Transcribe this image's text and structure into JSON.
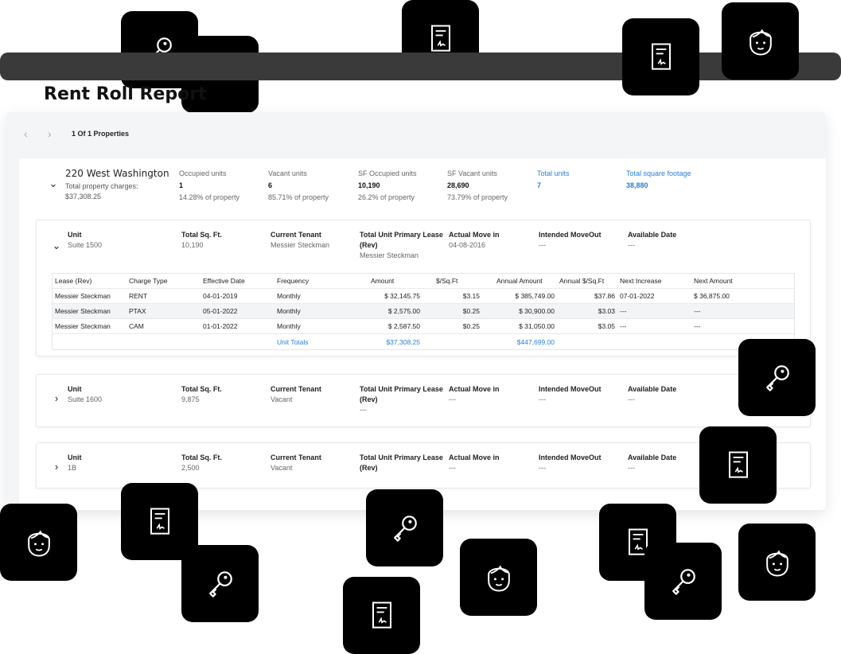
{
  "title": "Rent Roll Report",
  "pager": {
    "text": "1 Of 1 Properties"
  },
  "property": {
    "name": "220 West Washington",
    "charges_label": "Total property charges:",
    "charges_value": "$37,308.25",
    "stats": [
      {
        "label": "Occupied units",
        "value": "1",
        "pct": "14.28% of property"
      },
      {
        "label": "Vacant units",
        "value": "6",
        "pct": "85.71% of property"
      },
      {
        "label": "SF Occupied units",
        "value": "10,190",
        "pct": "26.2% of property"
      },
      {
        "label": "SF Vacant units",
        "value": "28,690",
        "pct": "73.79% of property"
      },
      {
        "label": "Total units",
        "value": "7",
        "pct": ""
      },
      {
        "label": "Total square footage",
        "value": "38,880",
        "pct": ""
      }
    ]
  },
  "unit_headers": {
    "unit": "Unit",
    "sqft": "Total Sq. Ft.",
    "tenant": "Current Tenant",
    "lease": "Total Unit Primary Lease (Rev)",
    "move_in": "Actual Move in",
    "move_out": "Intended MoveOut",
    "available": "Available Date"
  },
  "units": [
    {
      "unit": "Suite 1500",
      "sqft": "10,190",
      "tenant": "Messier Steckman",
      "lease": "Messier Steckman",
      "move_in": "04-08-2016",
      "move_out": "---",
      "available": "---"
    },
    {
      "unit": "Suite 1600",
      "sqft": "9,875",
      "tenant": "Vacant",
      "lease": "---",
      "move_in": "---",
      "move_out": "---",
      "available": "---"
    },
    {
      "unit": "1B",
      "sqft": "2,500",
      "tenant": "Vacant",
      "lease": "",
      "move_in": "---",
      "move_out": "---",
      "available": "---"
    }
  ],
  "lease_table": {
    "headers": [
      "Lease (Rev)",
      "Charge Type",
      "Effective Date",
      "Frequency",
      "Amount",
      "$/Sq.Ft",
      "Annual Amount",
      "Annual $/Sq.Ft",
      "Next Increase",
      "Next Amount"
    ],
    "rows": [
      [
        "Messier Steckman",
        "RENT",
        "04-01-2019",
        "Monthly",
        "$ 32,145.75",
        "$3.15",
        "$ 385,749.00",
        "$37.86",
        "07-01-2022",
        "$ 36,875.00"
      ],
      [
        "Messier Steckman",
        "PTAX",
        "05-01-2022",
        "Monthly",
        "$ 2,575.00",
        "$0.25",
        "$ 30,900.00",
        "$3.03",
        "---",
        "---"
      ],
      [
        "Messier Steckman",
        "CAM",
        "01-01-2022",
        "Monthly",
        "$ 2,587.50",
        "$0.25",
        "$ 31,050.00",
        "$3.05",
        "---",
        "---"
      ]
    ],
    "totals": {
      "label": "Unit Totals",
      "amount": "$37,308.25",
      "annual": "$447,699.00"
    }
  },
  "colors": {
    "accent": "#2a7fd4",
    "tile": "#000000",
    "topbar": "#3a3a3a"
  },
  "icons": {
    "prev": "chevron-left-icon",
    "next": "chevron-right-icon",
    "expanded": "chevron-down-icon",
    "collapsed": "chevron-right-icon"
  }
}
